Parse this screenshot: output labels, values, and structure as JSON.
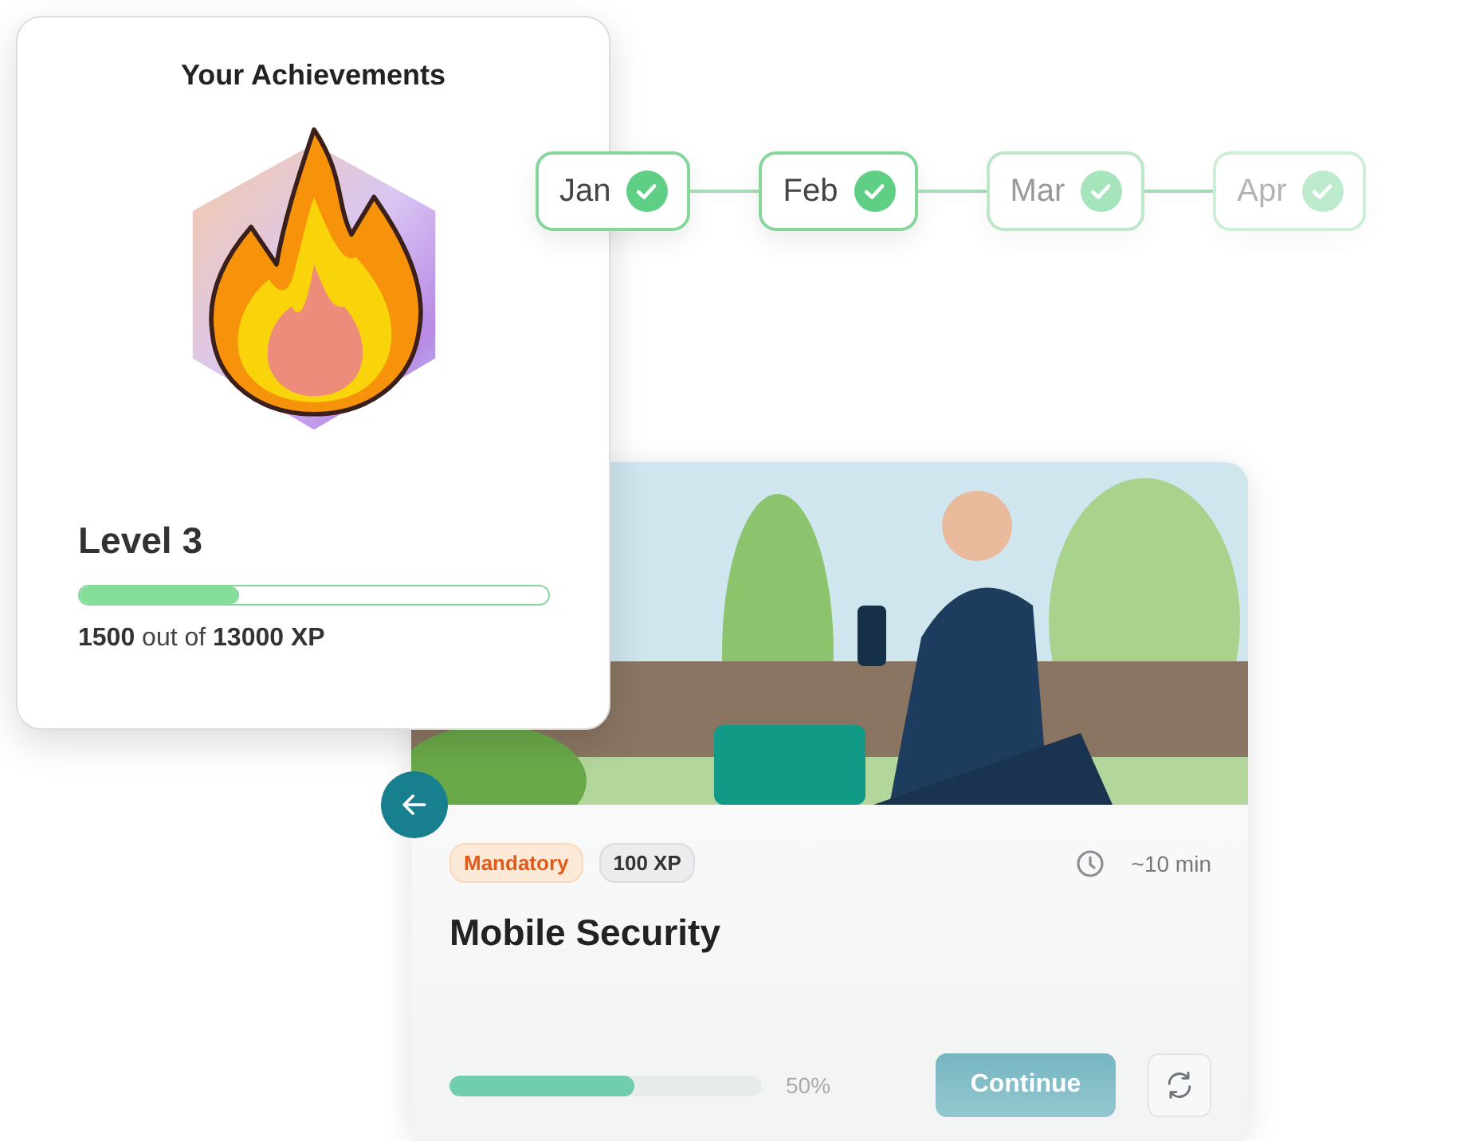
{
  "achievements": {
    "title": "Your Achievements",
    "level_label": "Level 3",
    "level": 0.34,
    "xp_current": "1500",
    "xp_sep": "out of",
    "xp_total": "13000 XP"
  },
  "timeline": [
    {
      "label": "Jan",
      "checked": true
    },
    {
      "label": "Feb",
      "checked": true
    },
    {
      "label": "Mar",
      "checked": true
    },
    {
      "label": "Apr",
      "checked": true
    }
  ],
  "course": {
    "tags": [
      {
        "label": "Mandatory",
        "kind": "warning"
      },
      {
        "label": "100 XP",
        "kind": "neutral"
      }
    ],
    "duration": "~10 min",
    "title": "Mobile Security",
    "level": 0.59,
    "percent": "50%",
    "button": "Continue"
  }
}
